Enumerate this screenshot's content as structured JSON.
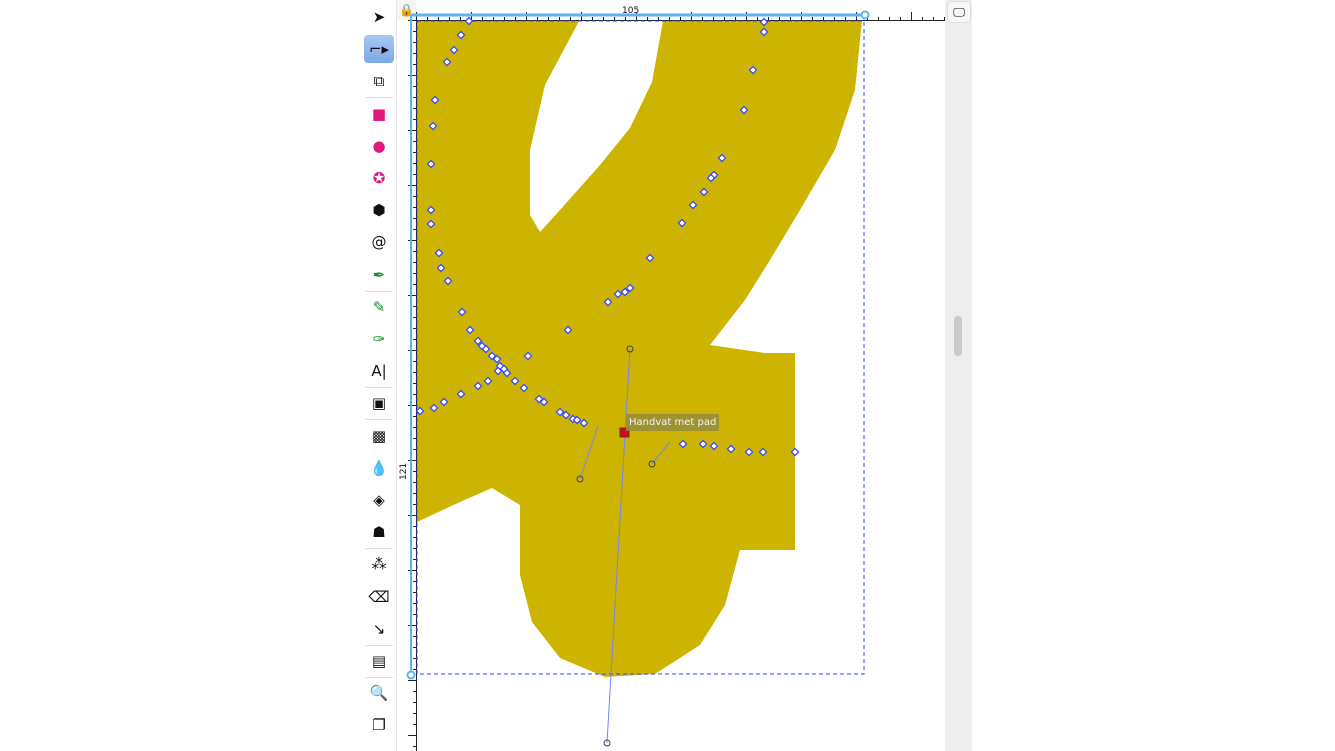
{
  "toolbar": {
    "tools": [
      {
        "name": "selector-tool",
        "glyph": "➤"
      },
      {
        "name": "node-tool",
        "glyph": "⌐▸",
        "active": true
      },
      {
        "name": "shape-builder-tool",
        "glyph": "⧉"
      },
      {
        "name": "rectangle-tool",
        "glyph": "■"
      },
      {
        "name": "ellipse-tool",
        "glyph": "●"
      },
      {
        "name": "star-tool",
        "glyph": "✪"
      },
      {
        "name": "3d-box-tool",
        "glyph": "⬢"
      },
      {
        "name": "spiral-tool",
        "glyph": "@"
      },
      {
        "name": "pen-tool",
        "glyph": "✒"
      },
      {
        "name": "pencil-tool",
        "glyph": "✎"
      },
      {
        "name": "calligraphy-tool",
        "glyph": "✑"
      },
      {
        "name": "text-tool",
        "glyph": "A|"
      },
      {
        "name": "gradient-tool",
        "glyph": "▣"
      },
      {
        "name": "mesh-tool",
        "glyph": "▩"
      },
      {
        "name": "dropper-tool",
        "glyph": "💧"
      },
      {
        "name": "paint-bucket-tool",
        "glyph": "◈"
      },
      {
        "name": "tweak-tool",
        "glyph": "☗"
      },
      {
        "name": "spray-tool",
        "glyph": "⁂"
      },
      {
        "name": "eraser-tool",
        "glyph": "⌫"
      },
      {
        "name": "connector-tool",
        "glyph": "↘"
      },
      {
        "name": "pages-tool",
        "glyph": "▤"
      },
      {
        "name": "zoom-tool",
        "glyph": "🔍"
      },
      {
        "name": "measure-tool",
        "glyph": "❐"
      }
    ]
  },
  "ruler": {
    "top_label": "105",
    "left_label": "121"
  },
  "canvas": {
    "tooltip": "Handvat met pad",
    "fill_color": "#CCB400",
    "node_color": "#3344ff"
  }
}
